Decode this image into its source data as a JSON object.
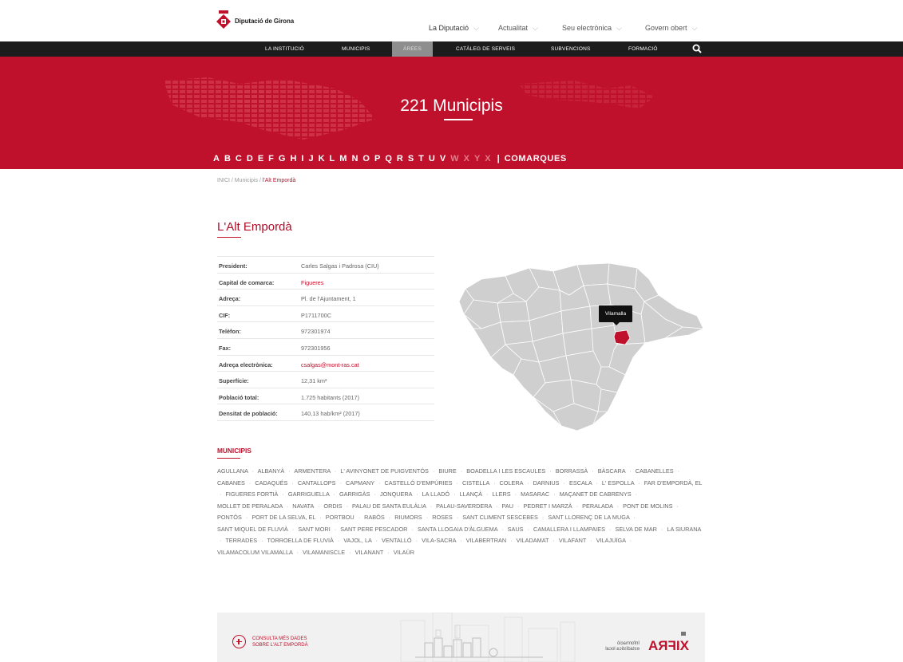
{
  "header": {
    "logo_text": "Diputació de Girona",
    "top_nav": [
      {
        "label": "La Diputació"
      },
      {
        "label": "Actualitat"
      },
      {
        "label": "Seu electrònica"
      },
      {
        "label": "Govern obert"
      }
    ],
    "main_menu": [
      {
        "label": "La Institució",
        "active": false
      },
      {
        "label": "Municipis",
        "active": false
      },
      {
        "label": "Àrees",
        "active": true
      },
      {
        "label": "Catàleg de serveis",
        "active": false
      },
      {
        "label": "Subvencions",
        "active": false
      },
      {
        "label": "Formació",
        "active": false
      }
    ]
  },
  "banner": {
    "title": "221 Municipis",
    "letters": [
      "A",
      "B",
      "C",
      "D",
      "E",
      "F",
      "G",
      "H",
      "I",
      "J",
      "K",
      "L",
      "M",
      "N",
      "O",
      "P",
      "Q",
      "R",
      "S",
      "T",
      "U",
      "V",
      "W",
      "X",
      "Y",
      "X"
    ],
    "dim_letters": [
      "W",
      "X",
      "Y",
      "X"
    ],
    "separator": "|",
    "comarques_label": "COMARQUES"
  },
  "breadcrumb": {
    "home": "INICI",
    "sep": " / ",
    "municipis": "Municipis",
    "current": "l'Alt Empordà"
  },
  "page_title": "L'Alt Empordà",
  "info": [
    {
      "label": "President:",
      "value": "Carles Salgas i Padrosa (CIU)",
      "link": false
    },
    {
      "label": "Capital de comarca:",
      "value": "Figueres",
      "link": true
    },
    {
      "label": "Adreça:",
      "value": "Pl. de l'Ajuntament, 1",
      "link": false
    },
    {
      "label": "CIF:",
      "value": "P1711700C",
      "link": false
    },
    {
      "label": "Telèfon:",
      "value": "972301974",
      "link": false
    },
    {
      "label": "Fax:",
      "value": "972301956",
      "link": false
    },
    {
      "label": "Adreça electrònica:",
      "value": "csalgas@mont-ras.cat",
      "link": true
    },
    {
      "label": "Superfície:",
      "value": "12,31 km²",
      "link": false
    },
    {
      "label": "Població total:",
      "value": "1.725 habitants (2017)",
      "link": false
    },
    {
      "label": "Densitat de població:",
      "value": "140,13 hab/km² (2017)",
      "link": false
    }
  ],
  "map": {
    "tooltip": "Vilamalla",
    "highlight_color": "#c0112c",
    "region_color": "#cfcfcf"
  },
  "municipis": {
    "title": "MUNICIPIS",
    "items": [
      "AGULLANA",
      "ALBANYÀ",
      "ARMENTERA",
      "L' AVINYONET DE PUIGVENTÓS",
      "BIURE",
      "BOADELLA I LES ESCAULES",
      "BORRASSÀ",
      "BÀSCARA",
      "CABANELLES",
      "CABANES",
      "CADAQUÉS",
      "CANTALLOPS",
      "CAPMANY",
      "CASTELLÓ D'EMPÚRIES",
      "CISTELLA",
      "COLERA",
      "DARNIUS",
      "ESCALA",
      "L' ESPOLLA",
      "FAR D'EMPORDÀ, EL",
      "FIGUERES FORTIÀ",
      "GARRIGUELLA",
      "GARRIGÀS",
      "JONQUERA",
      "LA LLADÓ",
      "LLANÇÀ",
      "LLERS",
      "MASARAC",
      "MAÇANET DE CABRENYS",
      "MOLLET DE PERALADA",
      "NAVATA",
      "ORDIS",
      "PALAU DE SANTA EULÀLIA",
      "PALAU-SAVERDERA",
      "PAU",
      "PEDRET I MARZÀ",
      "PERALADA",
      "PONT DE MOLINS",
      "PONTÓS",
      "PORT DE LA SELVA, EL",
      "PORTBOU",
      "RABÓS",
      "RIUMORS",
      "ROSES",
      "SANT CLIMENT SESCEBES",
      "SANT LLORENÇ DE LA MUGA",
      "SANT MIQUEL DE FLUVIÀ",
      "SANT MORI",
      "SANT PERE PESCADOR",
      "SANTA LLOGAIA D'ÀLGUEMA",
      "SAUS",
      "CAMALLERA I LLAMPAIES",
      "SELVA DE MAR",
      "LA SIURANA",
      "TERRADES",
      "TORROELLA DE FLUVIÀ",
      "VAJOL, LA",
      "VENTALLÓ",
      "VILA-SACRA",
      "VILABERTRAN",
      "VILADAMAT",
      "VILAFANT",
      "VILAJUÏGA",
      "VILAMACOLUM VILAMALLA",
      "VILAMANISCLE",
      "VILANANT",
      "VILAÜR"
    ]
  },
  "footer": {
    "consult_line1": "CONSULTA MÉS DADES",
    "consult_line2": "SOBRE L'ALT EMPORDÀ",
    "xifra_small": "Informació estadística local",
    "xifra_brand": "XIFRA"
  }
}
